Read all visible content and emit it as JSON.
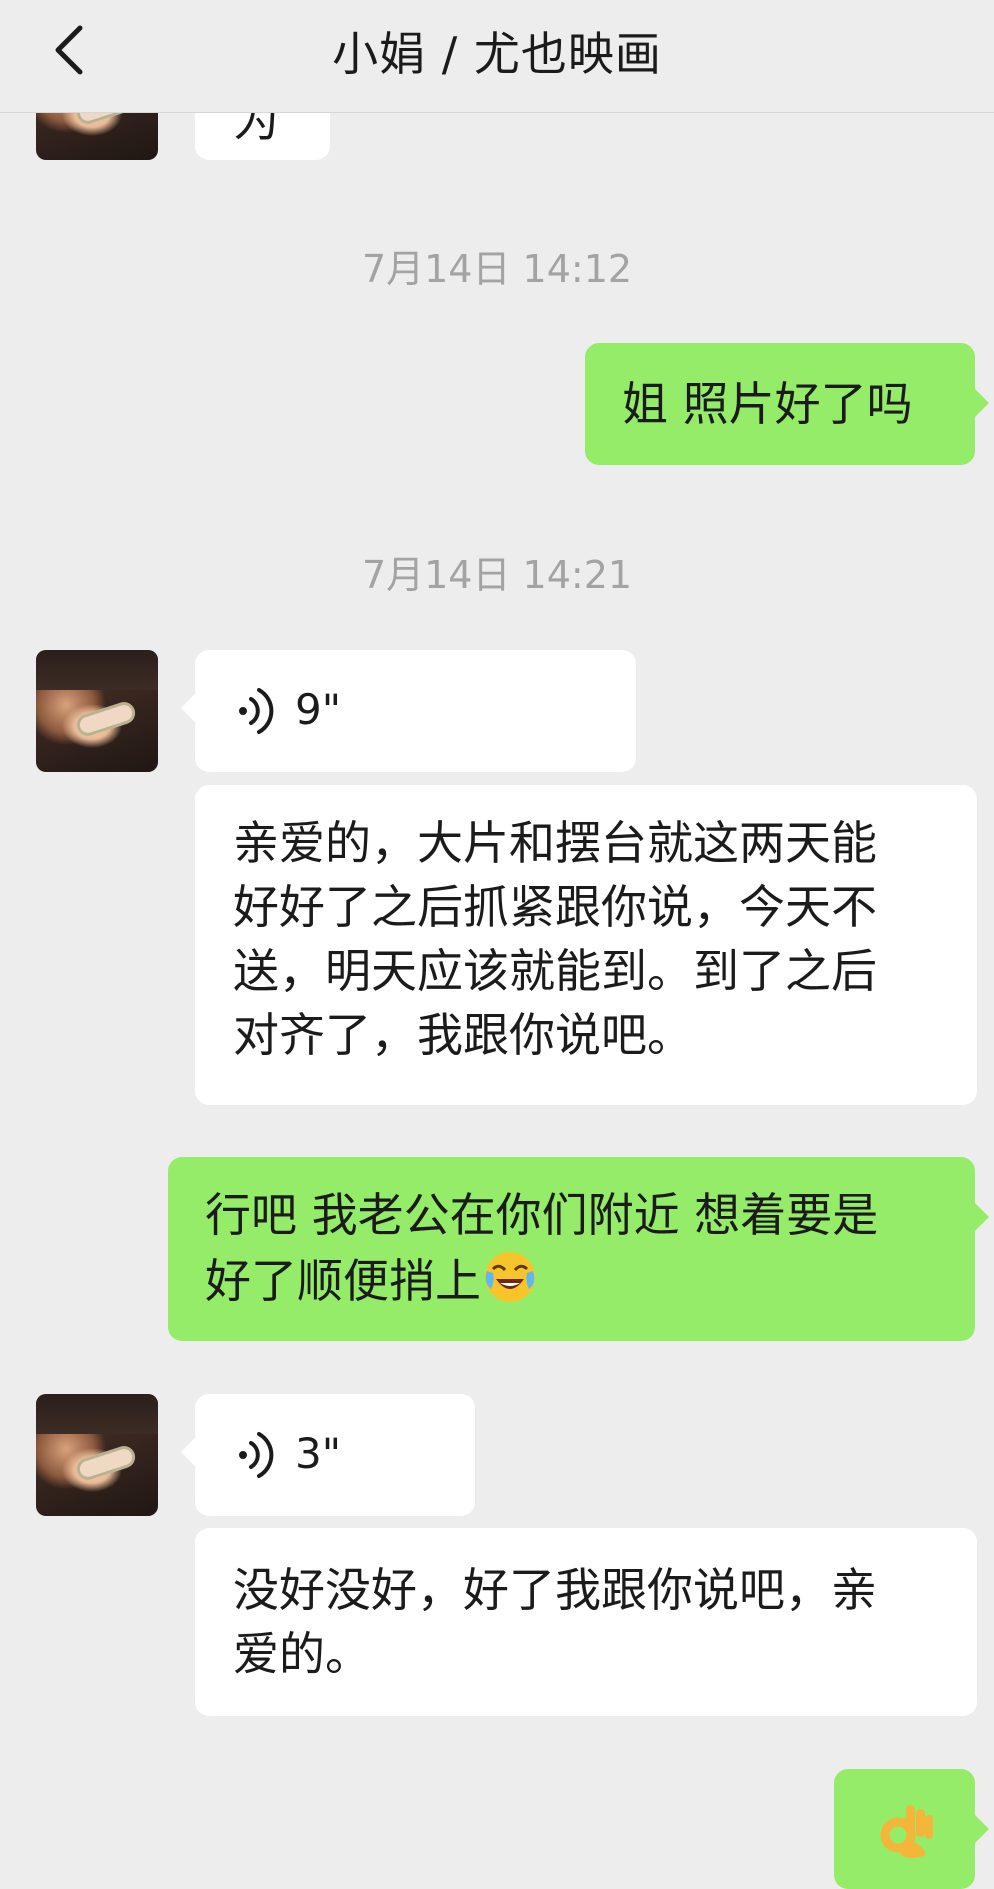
{
  "header": {
    "title": "小娟 / 尤也映画"
  },
  "timestamps": [
    "7月14日 14:12",
    "7月14日 14:21"
  ],
  "messages": {
    "partial_top": "为",
    "out_1": "姐 照片好了吗",
    "voice_1": "9\"",
    "in_1_lines": [
      "亲爱的，大片和摆台就这两天能",
      "好好了之后抓紧跟你说，今天不",
      "送，明天应该就能到。到了之后",
      "对齐了，我跟你说吧。"
    ],
    "out_2_lines": [
      "行吧 我老公在你们附近 想着要是",
      "好了顺便捎上"
    ],
    "voice_2": "3\"",
    "in_2_lines": [
      "没好没好，好了我跟你说吧，亲",
      "爱的。"
    ]
  },
  "icons": {
    "back": "chevron-left-icon",
    "voice": "voice-wave-icon",
    "laugh": "face-with-tears-of-joy-emoji",
    "ok": "ok-hand-emoji"
  },
  "colors": {
    "outgoing_bubble": "#95ec69",
    "incoming_bubble": "#ffffff",
    "background": "#ededed",
    "timestamp": "#a3a3a3"
  }
}
